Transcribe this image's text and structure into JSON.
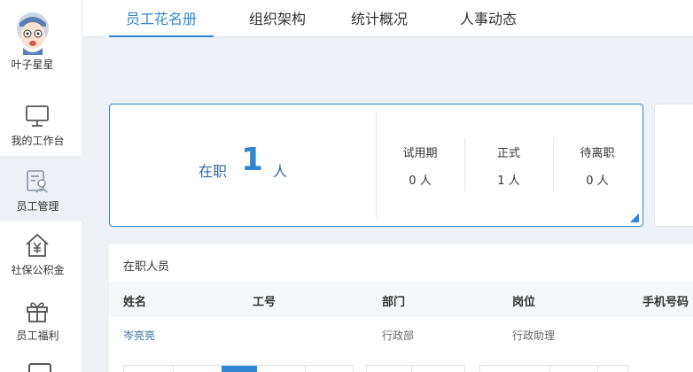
{
  "user": {
    "name": "叶子星星"
  },
  "sidebar": {
    "items": [
      {
        "label": "我的工作台"
      },
      {
        "label": "员工管理"
      },
      {
        "label": "社保公积金"
      },
      {
        "label": "员工福利"
      }
    ]
  },
  "tabs": [
    {
      "label": "员工花名册"
    },
    {
      "label": "组织架构"
    },
    {
      "label": "统计概况"
    },
    {
      "label": "人事动态"
    }
  ],
  "stats": {
    "on_job_label": "在职",
    "on_job_count": "1",
    "on_job_unit": "人",
    "probation": {
      "label": "试用期",
      "value": "0 人"
    },
    "formal": {
      "label": "正式",
      "value": "1 人"
    },
    "leaving": {
      "label": "待离职",
      "value": "0 人"
    }
  },
  "employees": {
    "title": "在职人员",
    "columns": [
      "姓名",
      "工号",
      "部门",
      "岗位",
      "手机号码"
    ],
    "rows": [
      {
        "name": "岑亮亮",
        "id": "",
        "dept": "行政部",
        "position": "行政助理"
      }
    ]
  },
  "colors": {
    "accent": "#2f86d1",
    "sidebar_active": "#edf0f4"
  }
}
